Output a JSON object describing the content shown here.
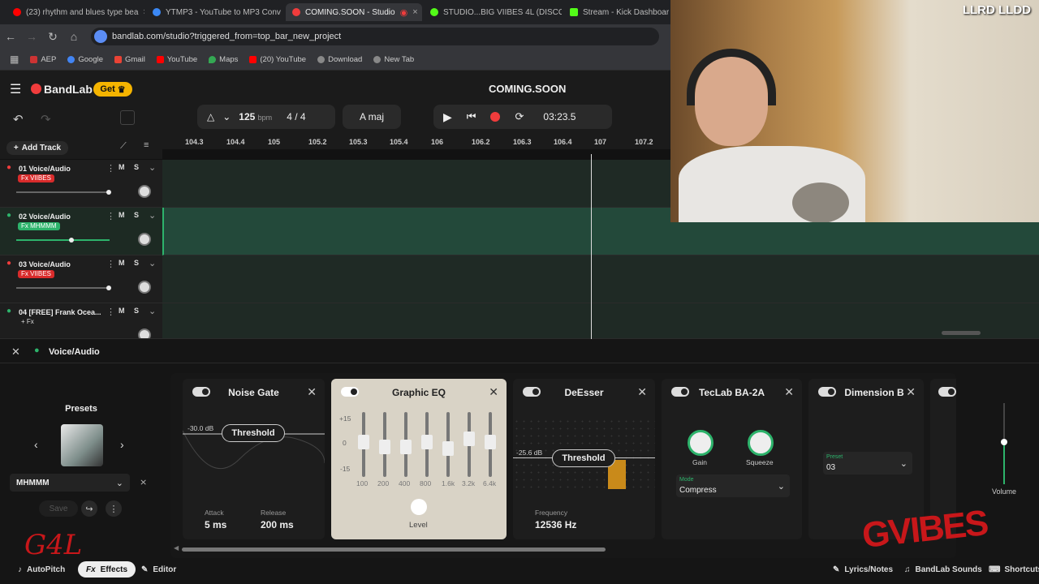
{
  "browser": {
    "tabs": [
      {
        "label": "(23) rhythm and blues type bea",
        "color": "#ff0000"
      },
      {
        "label": "YTMP3 - YouTube to MP3 Conv",
        "color": "#3b88f5"
      },
      {
        "label": "COMING.SOON - Studio",
        "color": "#f03c3c"
      },
      {
        "label": "STUDIO...BIG VIIBES 4L (DISCO",
        "color": "#53fc18"
      },
      {
        "label": "Stream - Kick Dashboard",
        "color": "#53fc18"
      }
    ],
    "url": "bandlab.com/studio?triggered_from=top_bar_new_project",
    "bookmarks": [
      {
        "label": "AEP",
        "color": "#c33"
      },
      {
        "label": "Google",
        "color": "#4285f4"
      },
      {
        "label": "Gmail",
        "color": "#ea4335"
      },
      {
        "label": "YouTube",
        "color": "#ff0000"
      },
      {
        "label": "Maps",
        "color": "#34a853"
      },
      {
        "label": "(20) YouTube",
        "color": "#ff0000"
      },
      {
        "label": "Download",
        "color": "#888"
      },
      {
        "label": "New Tab",
        "color": "#888"
      }
    ]
  },
  "app": {
    "brand": "BandLab",
    "get_label": "Get",
    "project_title": "COMING.SOON",
    "tempo": "125",
    "tempo_unit": "bpm",
    "time_sig": "4 / 4",
    "key": "A maj",
    "time": "03:23.5",
    "add_track": "Add Track",
    "accent": "#f03c3c"
  },
  "ruler": [
    "104.3",
    "104.4",
    "105",
    "105.2",
    "105.3",
    "105.4",
    "106",
    "106.2",
    "106.3",
    "106.4",
    "107",
    "107.2"
  ],
  "tracks": [
    {
      "name": "01  Voice/Audio",
      "fx": "Fx VIIBES",
      "fx_color": "#d92b2b",
      "vol": 0.9,
      "active": false
    },
    {
      "name": "02  Voice/Audio",
      "fx": "Fx MHMMM",
      "fx_color": "#2db36b",
      "vol": 0.58,
      "active": true
    },
    {
      "name": "03  Voice/Audio",
      "fx": "Fx VIIBES",
      "fx_color": "#d92b2b",
      "vol": 0.9,
      "active": false
    },
    {
      "name": "04  [FREE] Frank Ocea...",
      "fx": "+ Fx",
      "fx_color": "transparent",
      "vol": 0.48,
      "active": false
    }
  ],
  "track_buttons": {
    "m": "M",
    "s": "S"
  },
  "panel": {
    "title": "Voice/Audio",
    "presets_label": "Presets",
    "preset_name": "MHMMM",
    "save_label": "Save"
  },
  "effects": {
    "noise_gate": {
      "title": "Noise Gate",
      "threshold_label": "Threshold",
      "threshold_db": "-30.0 dB",
      "attack_label": "Attack",
      "attack": "5 ms",
      "release_label": "Release",
      "release": "200 ms"
    },
    "graphic_eq": {
      "title": "Graphic EQ",
      "scale": [
        "+15",
        "0",
        "-15"
      ],
      "bands": [
        "100",
        "200",
        "400",
        "800",
        "1.6k",
        "3.2k",
        "6.4k"
      ],
      "levels": [
        0.45,
        0.55,
        0.55,
        0.45,
        0.58,
        0.38,
        0.45
      ],
      "level_label": "Level"
    },
    "deesser": {
      "title": "DeEsser",
      "threshold_label": "Threshold",
      "threshold_db": "-25.6 dB",
      "freq_label": "Frequency",
      "freq": "12536 Hz"
    },
    "teclab": {
      "title": "TecLab BA-2A",
      "gain": "Gain",
      "squeeze": "Squeeze",
      "mode_label": "Mode",
      "mode": "Compress"
    },
    "dimension": {
      "title": "Dimension B",
      "preset_label": "Preset",
      "preset": "03"
    }
  },
  "volume_label": "Volume",
  "footer": {
    "autopitch": "AutoPitch",
    "effects": "Effects",
    "editor": "Editor",
    "lyrics": "Lyrics/Notes",
    "sounds": "BandLab Sounds",
    "shortcuts": "Shortcuts"
  },
  "overlays": {
    "webcam_tag": "LLRD LLDD",
    "watermark": "GVIBES",
    "signature": "G4L"
  }
}
